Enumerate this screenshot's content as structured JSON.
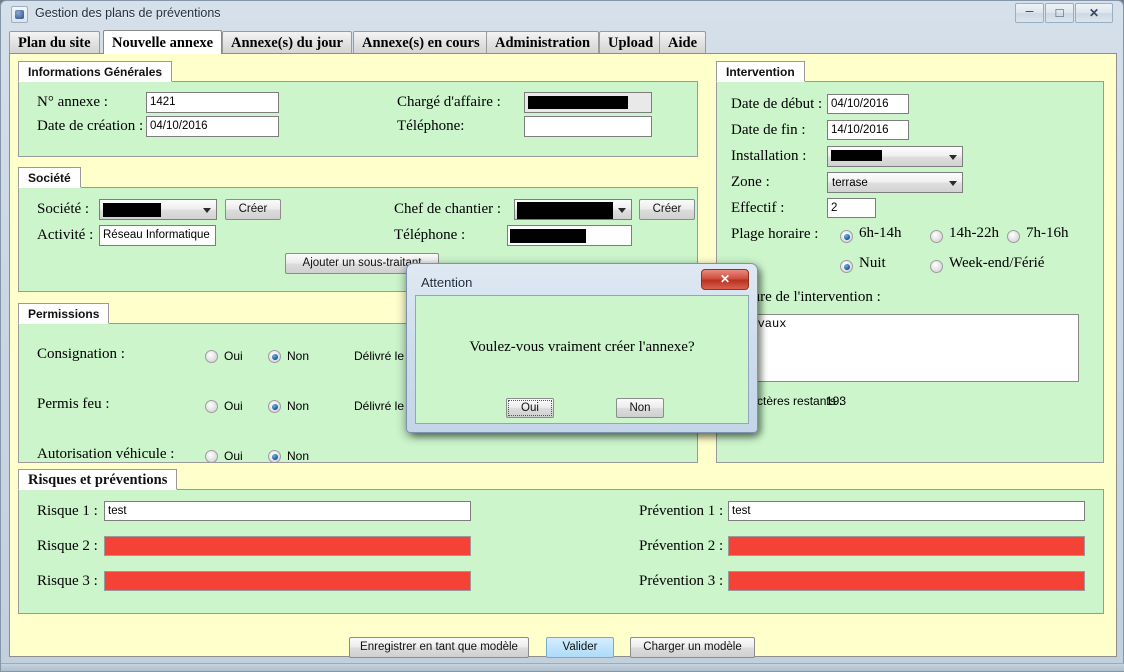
{
  "window": {
    "title": "Gestion des plans de préventions",
    "icon": "java-app-icon",
    "minimize": "minimize-icon",
    "maximize": "maximize-icon",
    "close": "close-icon"
  },
  "tabs": [
    {
      "label": "Plan du site",
      "active": false
    },
    {
      "label": "Nouvelle annexe",
      "active": true
    },
    {
      "label": "Annexe(s) du jour",
      "active": false
    },
    {
      "label": "Annexe(s) en cours",
      "active": false
    },
    {
      "label": "Administration",
      "active": false
    },
    {
      "label": "Upload",
      "active": false
    },
    {
      "label": "Aide",
      "active": false
    }
  ],
  "informations_generales": {
    "title": "Informations Générales",
    "num_annexe_label": "N° annexe :",
    "num_annexe_value": "1421",
    "date_creation_label": "Date de création :",
    "date_creation_value": "04/10/2016",
    "charge_affaire_label": "Chargé d'affaire :",
    "charge_affaire_value": "",
    "telephone_label": "Téléphone:",
    "telephone_value": ""
  },
  "societe": {
    "title": "Société",
    "societe_label": "Société :",
    "societe_value": "",
    "societe_creer": "Créer",
    "activite_label": "Activité :",
    "activite_value": "Réseau Informatique",
    "chef_chantier_label": "Chef de chantier :",
    "chef_chantier_value": "",
    "chef_creer": "Créer",
    "telephone_label": "Téléphone :",
    "telephone_value": "",
    "add_subcontractor": "Ajouter un sous-traitant"
  },
  "permissions": {
    "title": "Permissions",
    "oui": "Oui",
    "non": "Non",
    "delivre_le": "Délivré le :",
    "rows": [
      {
        "label": "Consignation :",
        "oui_selected": false,
        "non_selected": true,
        "has_delivre": true
      },
      {
        "label": "Permis feu :",
        "oui_selected": false,
        "non_selected": true,
        "has_delivre": true
      },
      {
        "label": "Autorisation véhicule :",
        "oui_selected": false,
        "non_selected": true,
        "has_delivre": false
      }
    ]
  },
  "intervention": {
    "title": "Intervention",
    "date_debut_label": "Date de début :",
    "date_debut_value": "04/10/2016",
    "date_fin_label": "Date de fin :",
    "date_fin_value": "14/10/2016",
    "installation_label": "Installation :",
    "installation_value": "",
    "zone_label": "Zone :",
    "zone_value": "terrase",
    "effectif_label": "Effectif :",
    "effectif_value": "2",
    "plage_horaire_label": "Plage horaire :",
    "plage_options": [
      {
        "label": "6h-14h",
        "selected": true
      },
      {
        "label": "14h-22h",
        "selected": false
      },
      {
        "label": "7h-16h",
        "selected": false
      },
      {
        "label": "Nuit",
        "selected": true
      },
      {
        "label": "Week-end/Férié",
        "selected": false
      }
    ],
    "nature_label": "Nature de l'intervention :",
    "nature_value": "travaux",
    "caracteres_restants_label": "Caractères restants :",
    "caracteres_restants_value": "193"
  },
  "risques": {
    "title": "Risques et préventions",
    "rows": [
      {
        "risque_label": "Risque 1 :",
        "risque_value": "test",
        "risque_error": false,
        "prevention_label": "Prévention 1 :",
        "prevention_value": "test",
        "prevention_error": false
      },
      {
        "risque_label": "Risque 2 :",
        "risque_value": "",
        "risque_error": true,
        "prevention_label": "Prévention 2 :",
        "prevention_value": "",
        "prevention_error": true
      },
      {
        "risque_label": "Risque 3 :",
        "risque_value": "",
        "risque_error": true,
        "prevention_label": "Prévention 3 :",
        "prevention_value": "",
        "prevention_error": true
      }
    ]
  },
  "footer": {
    "save_template": "Enregistrer en tant que modèle",
    "validate": "Valider",
    "load_template": "Charger un modèle"
  },
  "dialog": {
    "title": "Attention",
    "message": "Voulez-vous vraiment créer l'annexe?",
    "yes": "Oui",
    "no": "Non",
    "close": "close-icon"
  },
  "colors": {
    "panel_background": "#ffffcc",
    "group_background": "#ccf5cc",
    "error_field": "#f44336",
    "accent_button": "#bfe4fb"
  }
}
